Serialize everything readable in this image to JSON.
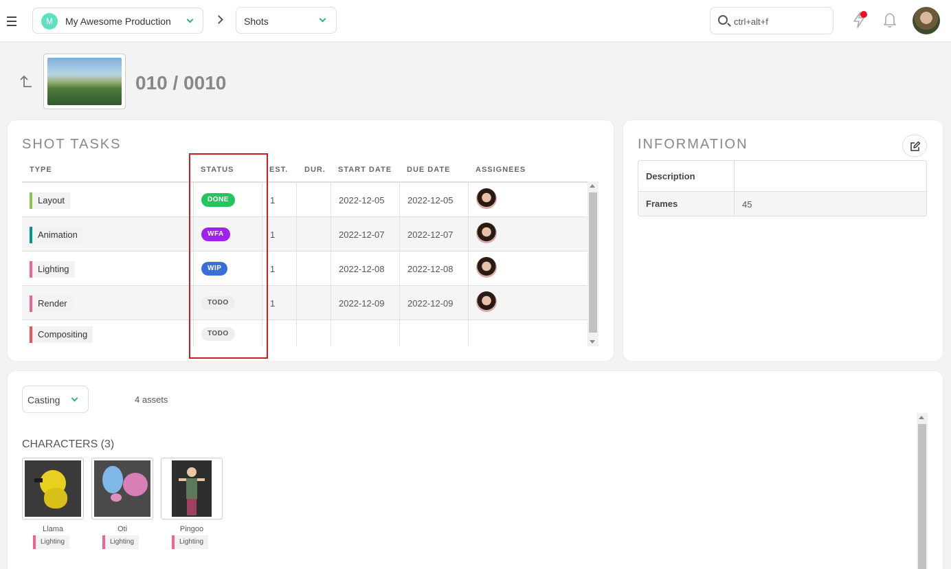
{
  "topbar": {
    "production": {
      "initial": "M",
      "name": "My Awesome Production"
    },
    "section": "Shots",
    "search_placeholder": "ctrl+alt+f"
  },
  "shot": {
    "title": "010 / 0010"
  },
  "tasks_panel": {
    "title": "SHOT TASKS",
    "columns": [
      "TYPE",
      "STATUS",
      "EST.",
      "DUR.",
      "START DATE",
      "DUE DATE",
      "ASSIGNEES"
    ],
    "rows": [
      {
        "type": "Layout",
        "type_color": "#8bc34a",
        "status": "DONE",
        "status_bg": "#22c55e",
        "status_fg": "#ffffff",
        "est": "1",
        "dur": "",
        "start": "2022-12-05",
        "due": "2022-12-05",
        "has_assignee": true
      },
      {
        "type": "Animation",
        "type_color": "#009688",
        "status": "WFA",
        "status_bg": "#a020f0",
        "status_fg": "#ffffff",
        "est": "1",
        "dur": "",
        "start": "2022-12-07",
        "due": "2022-12-07",
        "has_assignee": true
      },
      {
        "type": "Lighting",
        "type_color": "#f06292",
        "status": "WIP",
        "status_bg": "#3b6fd8",
        "status_fg": "#ffffff",
        "est": "1",
        "dur": "",
        "start": "2022-12-08",
        "due": "2022-12-08",
        "has_assignee": true
      },
      {
        "type": "Render",
        "type_color": "#f06292",
        "status": "TODO",
        "status_bg": "#eeeeee",
        "status_fg": "#555555",
        "est": "1",
        "dur": "",
        "start": "2022-12-09",
        "due": "2022-12-09",
        "has_assignee": true
      },
      {
        "type": "Compositing",
        "type_color": "#ef5350",
        "status": "TODO",
        "status_bg": "#eeeeee",
        "status_fg": "#555555",
        "est": "",
        "dur": "",
        "start": "",
        "due": "",
        "has_assignee": false
      }
    ]
  },
  "info_panel": {
    "title": "INFORMATION",
    "rows": [
      {
        "key": "Description",
        "value": ""
      },
      {
        "key": "Frames",
        "value": "45"
      }
    ]
  },
  "casting": {
    "view_select": "Casting",
    "asset_count": "4 assets",
    "category_title": "CHARACTERS (3)",
    "assets": [
      {
        "name": "Llama",
        "task": "Lighting",
        "task_color": "#f06292"
      },
      {
        "name": "Oti",
        "task": "Lighting",
        "task_color": "#f06292"
      },
      {
        "name": "Pingoo",
        "task": "Lighting",
        "task_color": "#f06292"
      }
    ]
  }
}
